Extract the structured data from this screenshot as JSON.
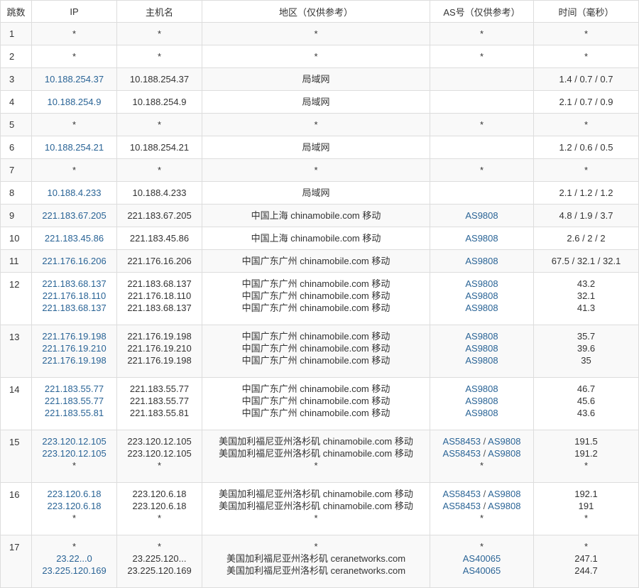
{
  "headers": [
    "跳数",
    "IP",
    "主机名",
    "地区（仅供参考）",
    "AS号（仅供参考）",
    "时间（毫秒）"
  ],
  "rows": [
    {
      "hop": "1",
      "lines": [
        {
          "ip": "*",
          "host": "*",
          "region": "*",
          "as": [
            "*"
          ],
          "time": "*"
        }
      ]
    },
    {
      "hop": "2",
      "lines": [
        {
          "ip": "*",
          "host": "*",
          "region": "*",
          "as": [
            "*"
          ],
          "time": "*"
        }
      ]
    },
    {
      "hop": "3",
      "lines": [
        {
          "ip": "10.188.254.37",
          "host": "10.188.254.37",
          "region": "局域网",
          "as": [],
          "time": "1.4 / 0.7 / 0.7"
        }
      ]
    },
    {
      "hop": "4",
      "lines": [
        {
          "ip": "10.188.254.9",
          "host": "10.188.254.9",
          "region": "局域网",
          "as": [],
          "time": "2.1 / 0.7 / 0.9"
        }
      ]
    },
    {
      "hop": "5",
      "lines": [
        {
          "ip": "*",
          "host": "*",
          "region": "*",
          "as": [
            "*"
          ],
          "time": "*"
        }
      ]
    },
    {
      "hop": "6",
      "lines": [
        {
          "ip": "10.188.254.21",
          "host": "10.188.254.21",
          "region": "局域网",
          "as": [],
          "time": "1.2 / 0.6 / 0.5"
        }
      ]
    },
    {
      "hop": "7",
      "lines": [
        {
          "ip": "*",
          "host": "*",
          "region": "*",
          "as": [
            "*"
          ],
          "time": "*"
        }
      ]
    },
    {
      "hop": "8",
      "lines": [
        {
          "ip": "10.188.4.233",
          "host": "10.188.4.233",
          "region": "局域网",
          "as": [],
          "time": "2.1 / 1.2 / 1.2"
        }
      ]
    },
    {
      "hop": "9",
      "lines": [
        {
          "ip": "221.183.67.205",
          "host": "221.183.67.205",
          "region": "中国上海 chinamobile.com 移动",
          "as": [
            "AS9808"
          ],
          "time": "4.8 / 1.9 / 3.7"
        }
      ]
    },
    {
      "hop": "10",
      "lines": [
        {
          "ip": "221.183.45.86",
          "host": "221.183.45.86",
          "region": "中国上海 chinamobile.com 移动",
          "as": [
            "AS9808"
          ],
          "time": "2.6 / 2 / 2"
        }
      ]
    },
    {
      "hop": "11",
      "lines": [
        {
          "ip": "221.176.16.206",
          "host": "221.176.16.206",
          "region": "中国广东广州 chinamobile.com 移动",
          "as": [
            "AS9808"
          ],
          "time": "67.5 / 32.1 / 32.1"
        }
      ]
    },
    {
      "hop": "12",
      "lines": [
        {
          "ip": "221.183.68.137",
          "host": "221.183.68.137",
          "region": "中国广东广州 chinamobile.com 移动",
          "as": [
            "AS9808"
          ],
          "time": "43.2"
        },
        {
          "ip": "221.176.18.110",
          "host": "221.176.18.110",
          "region": "中国广东广州 chinamobile.com 移动",
          "as": [
            "AS9808"
          ],
          "time": "32.1"
        },
        {
          "ip": "221.183.68.137",
          "host": "221.183.68.137",
          "region": "中国广东广州 chinamobile.com 移动",
          "as": [
            "AS9808"
          ],
          "time": "41.3"
        }
      ]
    },
    {
      "hop": "13",
      "lines": [
        {
          "ip": "221.176.19.198",
          "host": "221.176.19.198",
          "region": "中国广东广州 chinamobile.com 移动",
          "as": [
            "AS9808"
          ],
          "time": "35.7"
        },
        {
          "ip": "221.176.19.210",
          "host": "221.176.19.210",
          "region": "中国广东广州 chinamobile.com 移动",
          "as": [
            "AS9808"
          ],
          "time": "39.6"
        },
        {
          "ip": "221.176.19.198",
          "host": "221.176.19.198",
          "region": "中国广东广州 chinamobile.com 移动",
          "as": [
            "AS9808"
          ],
          "time": "35"
        }
      ]
    },
    {
      "hop": "14",
      "lines": [
        {
          "ip": "221.183.55.77",
          "host": "221.183.55.77",
          "region": "中国广东广州 chinamobile.com 移动",
          "as": [
            "AS9808"
          ],
          "time": "46.7"
        },
        {
          "ip": "221.183.55.77",
          "host": "221.183.55.77",
          "region": "中国广东广州 chinamobile.com 移动",
          "as": [
            "AS9808"
          ],
          "time": "45.6"
        },
        {
          "ip": "221.183.55.81",
          "host": "221.183.55.81",
          "region": "中国广东广州 chinamobile.com 移动",
          "as": [
            "AS9808"
          ],
          "time": "43.6"
        }
      ]
    },
    {
      "hop": "15",
      "lines": [
        {
          "ip": "223.120.12.105",
          "host": "223.120.12.105",
          "region": "美国加利福尼亚州洛杉矶 chinamobile.com 移动",
          "as": [
            "AS58453",
            "AS9808"
          ],
          "time": "191.5"
        },
        {
          "ip": "223.120.12.105",
          "host": "223.120.12.105",
          "region": "美国加利福尼亚州洛杉矶 chinamobile.com 移动",
          "as": [
            "AS58453",
            "AS9808"
          ],
          "time": "191.2"
        },
        {
          "ip": "*",
          "host": "*",
          "region": "*",
          "as": [
            "*"
          ],
          "time": "*"
        }
      ]
    },
    {
      "hop": "16",
      "lines": [
        {
          "ip": "223.120.6.18",
          "host": "223.120.6.18",
          "region": "美国加利福尼亚州洛杉矶 chinamobile.com 移动",
          "as": [
            "AS58453",
            "AS9808"
          ],
          "time": "192.1"
        },
        {
          "ip": "223.120.6.18",
          "host": "223.120.6.18",
          "region": "美国加利福尼亚州洛杉矶 chinamobile.com 移动",
          "as": [
            "AS58453",
            "AS9808"
          ],
          "time": "191"
        },
        {
          "ip": "*",
          "host": "*",
          "region": "*",
          "as": [
            "*"
          ],
          "time": "*"
        }
      ]
    },
    {
      "hop": "17",
      "lines": [
        {
          "ip": "*",
          "host": "*",
          "region": "*",
          "as": [
            "*"
          ],
          "time": "*"
        },
        {
          "ip": "23.22...0",
          "host": "23.225.120...",
          "region": "美国加利福尼亚州洛杉矶 ceranetworks.com",
          "as": [
            "AS40065"
          ],
          "time": "247.1"
        },
        {
          "ip": "23.225.120.169",
          "host": "23.225.120.169",
          "region": "美国加利福尼亚州洛杉矶 ceranetworks.com",
          "as": [
            "AS40065"
          ],
          "time": "244.7"
        }
      ]
    }
  ],
  "colors": {
    "link": "#2a6496",
    "text": "#333333",
    "border": "#dddddd",
    "stripe": "#f9f9f9"
  }
}
